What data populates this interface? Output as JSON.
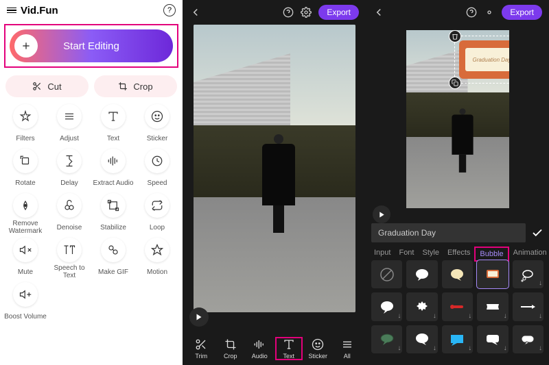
{
  "panel1": {
    "app_name": "Vid.Fun",
    "start_label": "Start Editing",
    "quick": {
      "cut": "Cut",
      "crop": "Crop"
    },
    "tools": [
      {
        "id": "filters",
        "label": "Filters"
      },
      {
        "id": "adjust",
        "label": "Adjust"
      },
      {
        "id": "text",
        "label": "Text"
      },
      {
        "id": "sticker",
        "label": "Sticker"
      },
      {
        "id": "rotate",
        "label": "Rotate"
      },
      {
        "id": "delay",
        "label": "Delay"
      },
      {
        "id": "extract-audio",
        "label": "Extract Audio"
      },
      {
        "id": "speed",
        "label": "Speed"
      },
      {
        "id": "remove-watermark",
        "label": "Remove Watermark"
      },
      {
        "id": "denoise",
        "label": "Denoise"
      },
      {
        "id": "stabilize",
        "label": "Stabilize"
      },
      {
        "id": "loop",
        "label": "Loop"
      },
      {
        "id": "mute",
        "label": "Mute"
      },
      {
        "id": "speech-to-text",
        "label": "Speech to Text"
      },
      {
        "id": "make-gif",
        "label": "Make GIF"
      },
      {
        "id": "motion",
        "label": "Motion"
      },
      {
        "id": "boost-volume",
        "label": "Boost Volume"
      }
    ]
  },
  "panel2": {
    "export": "Export",
    "toolbar": [
      {
        "id": "trim",
        "label": "Trim"
      },
      {
        "id": "crop",
        "label": "Crop"
      },
      {
        "id": "audio",
        "label": "Audio"
      },
      {
        "id": "text",
        "label": "Text",
        "hl": true
      },
      {
        "id": "sticker",
        "label": "Sticker"
      },
      {
        "id": "all",
        "label": "All"
      }
    ]
  },
  "panel3": {
    "export": "Export",
    "bubble_text": "Graduation Day",
    "input_value": "Graduation Day",
    "tabs": [
      "Input",
      "Font",
      "Style",
      "Effects",
      "Bubble",
      "Animation"
    ],
    "active_tab": "Bubble"
  }
}
